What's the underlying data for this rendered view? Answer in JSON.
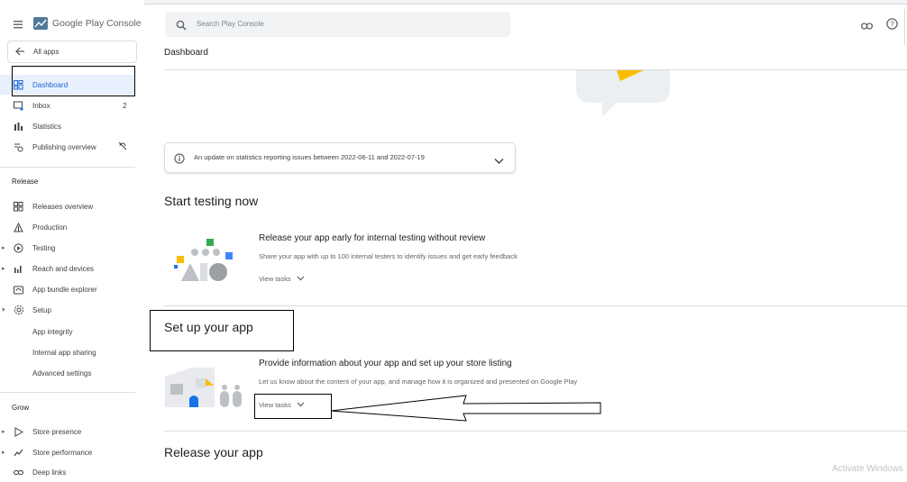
{
  "app": {
    "product": "Google Play Console"
  },
  "search": {
    "placeholder": "Search Play Console"
  },
  "sidebar": {
    "all_apps": "All apps",
    "items": [
      {
        "label": "Dashboard"
      },
      {
        "label": "Inbox",
        "badge": "2"
      },
      {
        "label": "Statistics"
      },
      {
        "label": "Publishing overview"
      }
    ],
    "release_heading": "Release",
    "release_items": [
      {
        "label": "Releases overview"
      },
      {
        "label": "Production"
      },
      {
        "label": "Testing"
      },
      {
        "label": "Reach and devices"
      },
      {
        "label": "App bundle explorer"
      },
      {
        "label": "Setup"
      },
      {
        "label": "App integrity"
      },
      {
        "label": "Internal app sharing"
      },
      {
        "label": "Advanced settings"
      }
    ],
    "grow_heading": "Grow",
    "grow_items": [
      {
        "label": "Store presence"
      },
      {
        "label": "Store performance"
      },
      {
        "label": "Deep links"
      }
    ]
  },
  "header": {
    "title": "Dashboard"
  },
  "notice": {
    "text": "An update on statistics reporting issues between 2022-06-11 and 2022-07-19"
  },
  "sections": {
    "testing": {
      "heading": "Start testing now",
      "card_title": "Release your app early for internal testing without review",
      "card_sub": "Share your app with up to 100 internal testers to identify issues and get early feedback",
      "view_tasks": "View tasks"
    },
    "setup": {
      "heading": "Set up your app",
      "card_title": "Provide information about your app and set up your store listing",
      "card_sub": "Let us know about the content of your app, and manage how it is organized and presented on Google Play",
      "view_tasks": "View tasks"
    },
    "release": {
      "heading": "Release your app"
    }
  },
  "watermark": "Activate Windows",
  "colors": {
    "accent": "#1a73e8",
    "selected_bg": "#e8f0fe",
    "text": "#202124",
    "muted": "#5f6368"
  }
}
